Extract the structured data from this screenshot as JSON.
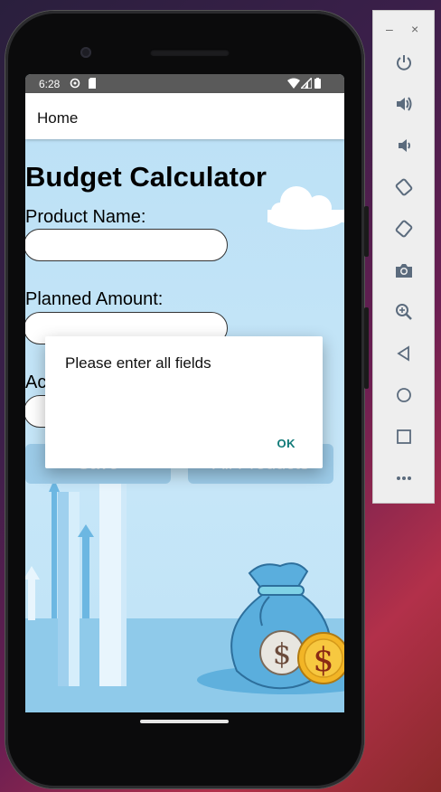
{
  "status_bar": {
    "time": "6:28"
  },
  "app_bar": {
    "title": "Home"
  },
  "form": {
    "heading": "Budget Calculator",
    "product_name_label": "Product Name:",
    "product_name_value": "",
    "planned_amount_label": "Planned Amount:",
    "planned_amount_value": "",
    "actual_amount_label_visible": "Ac",
    "actual_amount_value": "",
    "save_button_label": "Save",
    "all_products_button_label": "All Products"
  },
  "dialog": {
    "message": "Please enter all fields",
    "ok_label": "OK"
  },
  "emulator_toolbar": {
    "minimize": "–",
    "close": "×",
    "buttons": [
      "power-icon",
      "volume-up-icon",
      "volume-down-icon",
      "rotate-left-icon",
      "rotate-right-icon",
      "camera-icon",
      "zoom-icon",
      "back-icon",
      "home-icon",
      "overview-icon",
      "more-icon"
    ]
  },
  "colors": {
    "sky": "#bfe3f6",
    "dialog_accent": "#107a78",
    "button_disabled": "#9ccbe8"
  }
}
